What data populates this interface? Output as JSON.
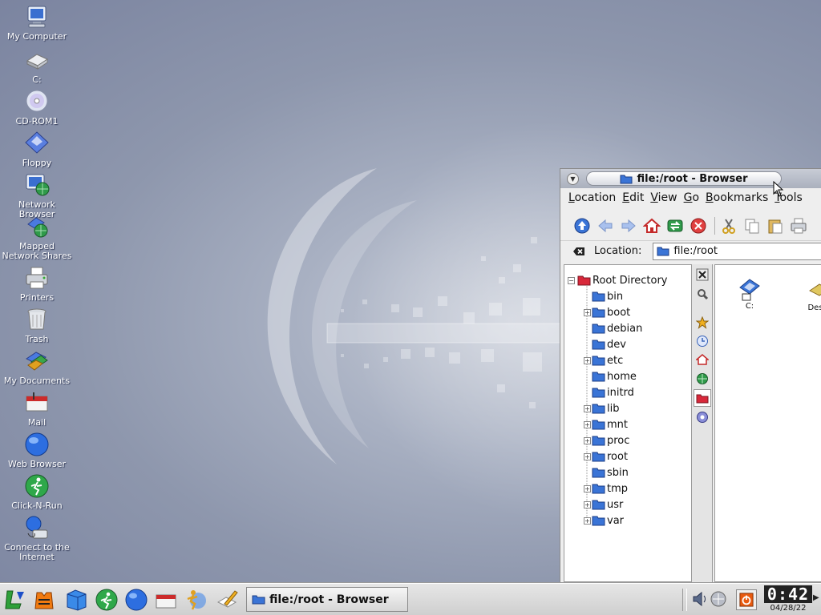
{
  "desktop": {
    "icons": [
      {
        "label": "My Computer",
        "icon": "computer-icon"
      },
      {
        "label": "C:",
        "icon": "hard-drive-icon"
      },
      {
        "label": "CD-ROM1",
        "icon": "cdrom-icon"
      },
      {
        "label": "Floppy",
        "icon": "floppy-icon"
      },
      {
        "label": "Network Browser",
        "icon": "network-browser-icon"
      },
      {
        "label": "Mapped Network Shares",
        "icon": "network-shares-icon"
      },
      {
        "label": "Printers",
        "icon": "printer-icon"
      },
      {
        "label": "Trash",
        "icon": "trash-icon"
      },
      {
        "label": "My Documents",
        "icon": "documents-icon"
      },
      {
        "label": "Mail",
        "icon": "mail-icon"
      },
      {
        "label": "Web Browser",
        "icon": "globe-icon"
      },
      {
        "label": "Click-N-Run",
        "icon": "click-n-run-icon"
      },
      {
        "label": "Connect to the Internet",
        "icon": "connect-internet-icon"
      }
    ]
  },
  "window": {
    "title": "file:/root - Browser",
    "menu": [
      "Location",
      "Edit",
      "View",
      "Go",
      "Bookmarks",
      "Tools"
    ],
    "location_label": "Location:",
    "location_value": "file:/root",
    "tree": {
      "root": "Root Directory",
      "items": [
        {
          "name": "bin",
          "expandable": false
        },
        {
          "name": "boot",
          "expandable": true
        },
        {
          "name": "debian",
          "expandable": false
        },
        {
          "name": "dev",
          "expandable": false
        },
        {
          "name": "etc",
          "expandable": true
        },
        {
          "name": "home",
          "expandable": false
        },
        {
          "name": "initrd",
          "expandable": false
        },
        {
          "name": "lib",
          "expandable": true
        },
        {
          "name": "mnt",
          "expandable": true
        },
        {
          "name": "proc",
          "expandable": true
        },
        {
          "name": "root",
          "expandable": true
        },
        {
          "name": "sbin",
          "expandable": false
        },
        {
          "name": "tmp",
          "expandable": true
        },
        {
          "name": "usr",
          "expandable": true
        },
        {
          "name": "var",
          "expandable": true
        }
      ]
    },
    "files": [
      {
        "label": "C:",
        "icon": "drive-shortcut-icon"
      },
      {
        "label": "Des",
        "icon": "desktop-folder-icon"
      }
    ]
  },
  "taskbar": {
    "task_title": "file:/root - Browser",
    "clock_time": "0:42",
    "clock_date": "04/28/22"
  },
  "colors": {
    "folder_blue": "#3a74d6",
    "root_folder_red": "#d8283a",
    "title_pill": "#e6e8ee"
  }
}
